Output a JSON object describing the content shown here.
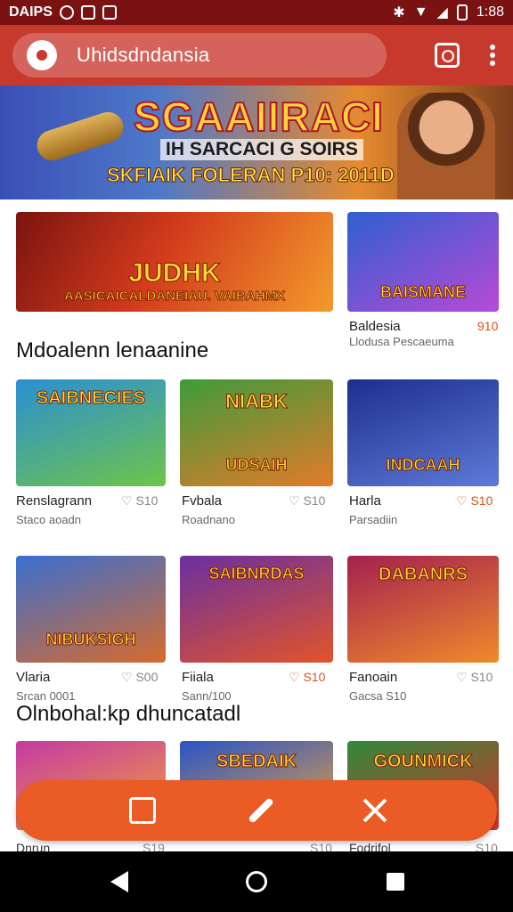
{
  "status_bar": {
    "left_text": "DAIPS",
    "time": "1:88"
  },
  "app_bar": {
    "search_text": "Uhidsdndansia"
  },
  "hero": {
    "title": "SGAAIIRACI",
    "subtitle": "IH SARCACI G SOIRS",
    "tagline": "SKFIAIK FOLERAN P10: 2011D"
  },
  "featured": [
    {
      "art_text": "JUDHK",
      "banner_text": "AASICAICALDANEIAU. VAIBAHMX",
      "colors": [
        "#d23a1c",
        "#f39a2c"
      ]
    },
    {
      "art_text": "BAISMANE",
      "label": "Baldesia",
      "sub": "Llodusa Pescaeuma",
      "price": "910",
      "colors": [
        "#2f5fd0",
        "#b84ad6"
      ]
    }
  ],
  "sections": [
    {
      "title": "Mdoalenn lenaanine"
    },
    {
      "title": "Olnbohal:kp dhuncatadl"
    }
  ],
  "grid_row1": [
    {
      "art_text": "SAIBNECIES",
      "label": "Renslagrann",
      "sub": "Staco aoadn",
      "price": "S10",
      "hot": false,
      "colors": [
        "#2a8fd4",
        "#6ec44a"
      ]
    },
    {
      "art_text": "NIABK",
      "art_text2": "UDSAIH",
      "label": "Fvbala",
      "sub": "Roadnano",
      "price": "S10",
      "hot": false,
      "colors": [
        "#3e9b3a",
        "#e27b2a"
      ]
    },
    {
      "art_text": "INDCAAH",
      "label": "Harla",
      "sub": "Parsadiin",
      "price": "S10",
      "hot": true,
      "colors": [
        "#1d2f8c",
        "#5e7ad8"
      ]
    }
  ],
  "grid_row2": [
    {
      "art_text": "NIBUKSIGH",
      "label": "Vlaria",
      "sub": "Srcan 0001",
      "price": "S00",
      "hot": false,
      "colors": [
        "#3a6fd0",
        "#d66b2c"
      ]
    },
    {
      "art_text": "SAIBNRDAS",
      "label": "Fiiala",
      "sub": "Sann/100",
      "price": "S10",
      "hot": true,
      "colors": [
        "#6a2fa0",
        "#e2542a"
      ]
    },
    {
      "art_text": "DABANRS",
      "label": "Fanoain",
      "sub": "Gacsa S10",
      "price": "S10",
      "hot": false,
      "colors": [
        "#a42050",
        "#f08a2a"
      ]
    }
  ],
  "grid_row3": [
    {
      "art_text": "",
      "label": "Dnrun",
      "price": "S19",
      "colors": [
        "#c53aa3",
        "#f1a23b"
      ]
    },
    {
      "art_text": "SBEDAIK",
      "label": "",
      "price": "S10",
      "colors": [
        "#2854c8",
        "#f0a437"
      ]
    },
    {
      "art_text": "GOUNMICK",
      "label": "Fodrifol",
      "price": "S10",
      "colors": [
        "#2e8a3a",
        "#d8322b"
      ]
    }
  ]
}
